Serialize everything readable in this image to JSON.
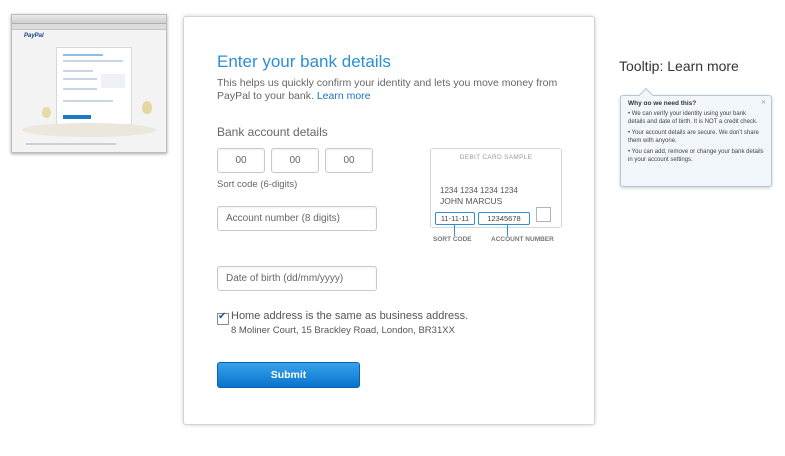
{
  "form": {
    "title": "Enter your bank details",
    "intro": "This helps us quickly confirm your identity and lets you move money from PayPal to your bank.",
    "learn_more": "Learn more",
    "section_label": "Bank account details",
    "sort_code_placeholders": [
      "00",
      "00",
      "00"
    ],
    "sort_code_hint": "Sort code (6-digits)",
    "account_number_placeholder": "Account number (8 digits)",
    "dob_placeholder": "Date of birth (dd/mm/yyyy)",
    "home_address_checked": true,
    "home_address_label": "Home address is the same as business address.",
    "address": "8 Moliner Court, 15 Brackley Road, London, BR31XX",
    "submit_label": "Submit"
  },
  "card_sample": {
    "title": "DEBIT CARD SAMPLE",
    "number": "1234 1234 1234 1234",
    "name": "JOHN MARCUS",
    "sort_code": "11-11-11",
    "account_number": "12345678",
    "sort_code_label": "SORT CODE",
    "account_number_label": "ACCOUNT NUMBER"
  },
  "tooltip": {
    "heading": "Tooltip: Learn more",
    "title": "Why do we need this?",
    "items": [
      "• We can verify your identity using your bank details and date of birth. It is NOT a credit check.",
      "• Your account details are secure. We don't share them with anyone.",
      "• You can add, remove or change your bank details in your account settings."
    ]
  },
  "thumbnail": {
    "logo": "PayPal"
  },
  "colors": {
    "accent": "#2a8fd4",
    "button": "#0a73cc",
    "tooltip_bg": "#f1f6fb"
  }
}
